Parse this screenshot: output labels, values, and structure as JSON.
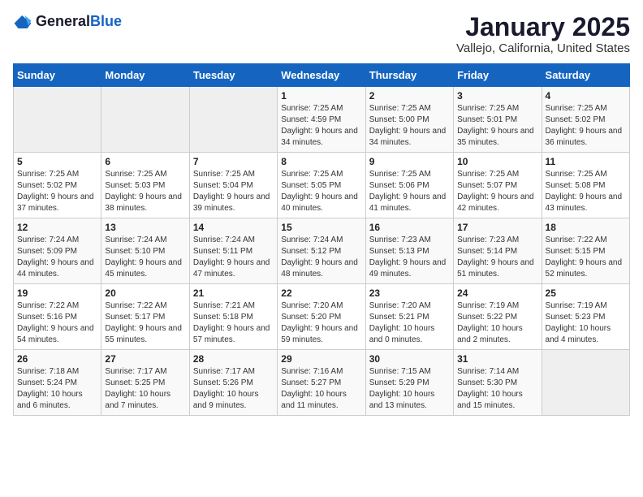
{
  "logo": {
    "general": "General",
    "blue": "Blue"
  },
  "title": "January 2025",
  "subtitle": "Vallejo, California, United States",
  "days_of_week": [
    "Sunday",
    "Monday",
    "Tuesday",
    "Wednesday",
    "Thursday",
    "Friday",
    "Saturday"
  ],
  "weeks": [
    [
      {
        "day": "",
        "sunrise": "",
        "sunset": "",
        "daylight": ""
      },
      {
        "day": "",
        "sunrise": "",
        "sunset": "",
        "daylight": ""
      },
      {
        "day": "",
        "sunrise": "",
        "sunset": "",
        "daylight": ""
      },
      {
        "day": "1",
        "sunrise": "Sunrise: 7:25 AM",
        "sunset": "Sunset: 4:59 PM",
        "daylight": "Daylight: 9 hours and 34 minutes."
      },
      {
        "day": "2",
        "sunrise": "Sunrise: 7:25 AM",
        "sunset": "Sunset: 5:00 PM",
        "daylight": "Daylight: 9 hours and 34 minutes."
      },
      {
        "day": "3",
        "sunrise": "Sunrise: 7:25 AM",
        "sunset": "Sunset: 5:01 PM",
        "daylight": "Daylight: 9 hours and 35 minutes."
      },
      {
        "day": "4",
        "sunrise": "Sunrise: 7:25 AM",
        "sunset": "Sunset: 5:02 PM",
        "daylight": "Daylight: 9 hours and 36 minutes."
      }
    ],
    [
      {
        "day": "5",
        "sunrise": "Sunrise: 7:25 AM",
        "sunset": "Sunset: 5:02 PM",
        "daylight": "Daylight: 9 hours and 37 minutes."
      },
      {
        "day": "6",
        "sunrise": "Sunrise: 7:25 AM",
        "sunset": "Sunset: 5:03 PM",
        "daylight": "Daylight: 9 hours and 38 minutes."
      },
      {
        "day": "7",
        "sunrise": "Sunrise: 7:25 AM",
        "sunset": "Sunset: 5:04 PM",
        "daylight": "Daylight: 9 hours and 39 minutes."
      },
      {
        "day": "8",
        "sunrise": "Sunrise: 7:25 AM",
        "sunset": "Sunset: 5:05 PM",
        "daylight": "Daylight: 9 hours and 40 minutes."
      },
      {
        "day": "9",
        "sunrise": "Sunrise: 7:25 AM",
        "sunset": "Sunset: 5:06 PM",
        "daylight": "Daylight: 9 hours and 41 minutes."
      },
      {
        "day": "10",
        "sunrise": "Sunrise: 7:25 AM",
        "sunset": "Sunset: 5:07 PM",
        "daylight": "Daylight: 9 hours and 42 minutes."
      },
      {
        "day": "11",
        "sunrise": "Sunrise: 7:25 AM",
        "sunset": "Sunset: 5:08 PM",
        "daylight": "Daylight: 9 hours and 43 minutes."
      }
    ],
    [
      {
        "day": "12",
        "sunrise": "Sunrise: 7:24 AM",
        "sunset": "Sunset: 5:09 PM",
        "daylight": "Daylight: 9 hours and 44 minutes."
      },
      {
        "day": "13",
        "sunrise": "Sunrise: 7:24 AM",
        "sunset": "Sunset: 5:10 PM",
        "daylight": "Daylight: 9 hours and 45 minutes."
      },
      {
        "day": "14",
        "sunrise": "Sunrise: 7:24 AM",
        "sunset": "Sunset: 5:11 PM",
        "daylight": "Daylight: 9 hours and 47 minutes."
      },
      {
        "day": "15",
        "sunrise": "Sunrise: 7:24 AM",
        "sunset": "Sunset: 5:12 PM",
        "daylight": "Daylight: 9 hours and 48 minutes."
      },
      {
        "day": "16",
        "sunrise": "Sunrise: 7:23 AM",
        "sunset": "Sunset: 5:13 PM",
        "daylight": "Daylight: 9 hours and 49 minutes."
      },
      {
        "day": "17",
        "sunrise": "Sunrise: 7:23 AM",
        "sunset": "Sunset: 5:14 PM",
        "daylight": "Daylight: 9 hours and 51 minutes."
      },
      {
        "day": "18",
        "sunrise": "Sunrise: 7:22 AM",
        "sunset": "Sunset: 5:15 PM",
        "daylight": "Daylight: 9 hours and 52 minutes."
      }
    ],
    [
      {
        "day": "19",
        "sunrise": "Sunrise: 7:22 AM",
        "sunset": "Sunset: 5:16 PM",
        "daylight": "Daylight: 9 hours and 54 minutes."
      },
      {
        "day": "20",
        "sunrise": "Sunrise: 7:22 AM",
        "sunset": "Sunset: 5:17 PM",
        "daylight": "Daylight: 9 hours and 55 minutes."
      },
      {
        "day": "21",
        "sunrise": "Sunrise: 7:21 AM",
        "sunset": "Sunset: 5:18 PM",
        "daylight": "Daylight: 9 hours and 57 minutes."
      },
      {
        "day": "22",
        "sunrise": "Sunrise: 7:20 AM",
        "sunset": "Sunset: 5:20 PM",
        "daylight": "Daylight: 9 hours and 59 minutes."
      },
      {
        "day": "23",
        "sunrise": "Sunrise: 7:20 AM",
        "sunset": "Sunset: 5:21 PM",
        "daylight": "Daylight: 10 hours and 0 minutes."
      },
      {
        "day": "24",
        "sunrise": "Sunrise: 7:19 AM",
        "sunset": "Sunset: 5:22 PM",
        "daylight": "Daylight: 10 hours and 2 minutes."
      },
      {
        "day": "25",
        "sunrise": "Sunrise: 7:19 AM",
        "sunset": "Sunset: 5:23 PM",
        "daylight": "Daylight: 10 hours and 4 minutes."
      }
    ],
    [
      {
        "day": "26",
        "sunrise": "Sunrise: 7:18 AM",
        "sunset": "Sunset: 5:24 PM",
        "daylight": "Daylight: 10 hours and 6 minutes."
      },
      {
        "day": "27",
        "sunrise": "Sunrise: 7:17 AM",
        "sunset": "Sunset: 5:25 PM",
        "daylight": "Daylight: 10 hours and 7 minutes."
      },
      {
        "day": "28",
        "sunrise": "Sunrise: 7:17 AM",
        "sunset": "Sunset: 5:26 PM",
        "daylight": "Daylight: 10 hours and 9 minutes."
      },
      {
        "day": "29",
        "sunrise": "Sunrise: 7:16 AM",
        "sunset": "Sunset: 5:27 PM",
        "daylight": "Daylight: 10 hours and 11 minutes."
      },
      {
        "day": "30",
        "sunrise": "Sunrise: 7:15 AM",
        "sunset": "Sunset: 5:29 PM",
        "daylight": "Daylight: 10 hours and 13 minutes."
      },
      {
        "day": "31",
        "sunrise": "Sunrise: 7:14 AM",
        "sunset": "Sunset: 5:30 PM",
        "daylight": "Daylight: 10 hours and 15 minutes."
      },
      {
        "day": "",
        "sunrise": "",
        "sunset": "",
        "daylight": ""
      }
    ]
  ]
}
